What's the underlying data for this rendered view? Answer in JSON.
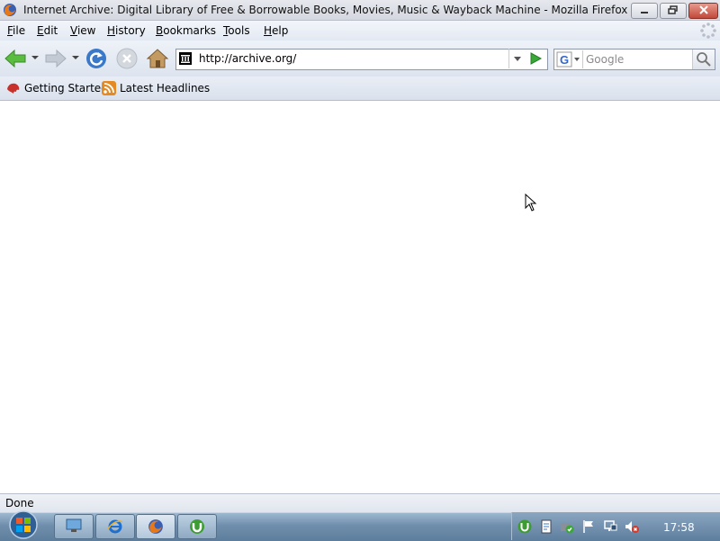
{
  "window": {
    "title": "Internet Archive: Digital Library of Free & Borrowable Books, Movies, Music & Wayback Machine - Mozilla Firefox",
    "icons": {
      "app": "firefox-icon",
      "minimize": "minimize-icon",
      "maximize": "maximize-icon",
      "close": "close-icon"
    }
  },
  "menu": [
    "File",
    "Edit",
    "View",
    "History",
    "Bookmarks",
    "Tools",
    "Help"
  ],
  "toolbar": {
    "url": "http://archive.org/",
    "search_placeholder": "Google",
    "icons": [
      "back-icon",
      "forward-icon",
      "reload-icon",
      "stop-icon",
      "home-icon",
      "go-icon",
      "search-icon"
    ]
  },
  "bookmarks": [
    {
      "label": "Getting Started",
      "icon": "getting-started-icon"
    },
    {
      "label": "Latest Headlines",
      "icon": "rss-icon"
    }
  ],
  "status": "Done",
  "taskbar": {
    "clock": "17:58",
    "apps": [
      "show-desktop-icon",
      "internet-explorer-icon",
      "firefox-icon",
      "utorrent-icon"
    ]
  },
  "colors": {
    "accent": "#3a78c9",
    "go_green": "#3aa838",
    "taskbar": "#6f8eac"
  }
}
